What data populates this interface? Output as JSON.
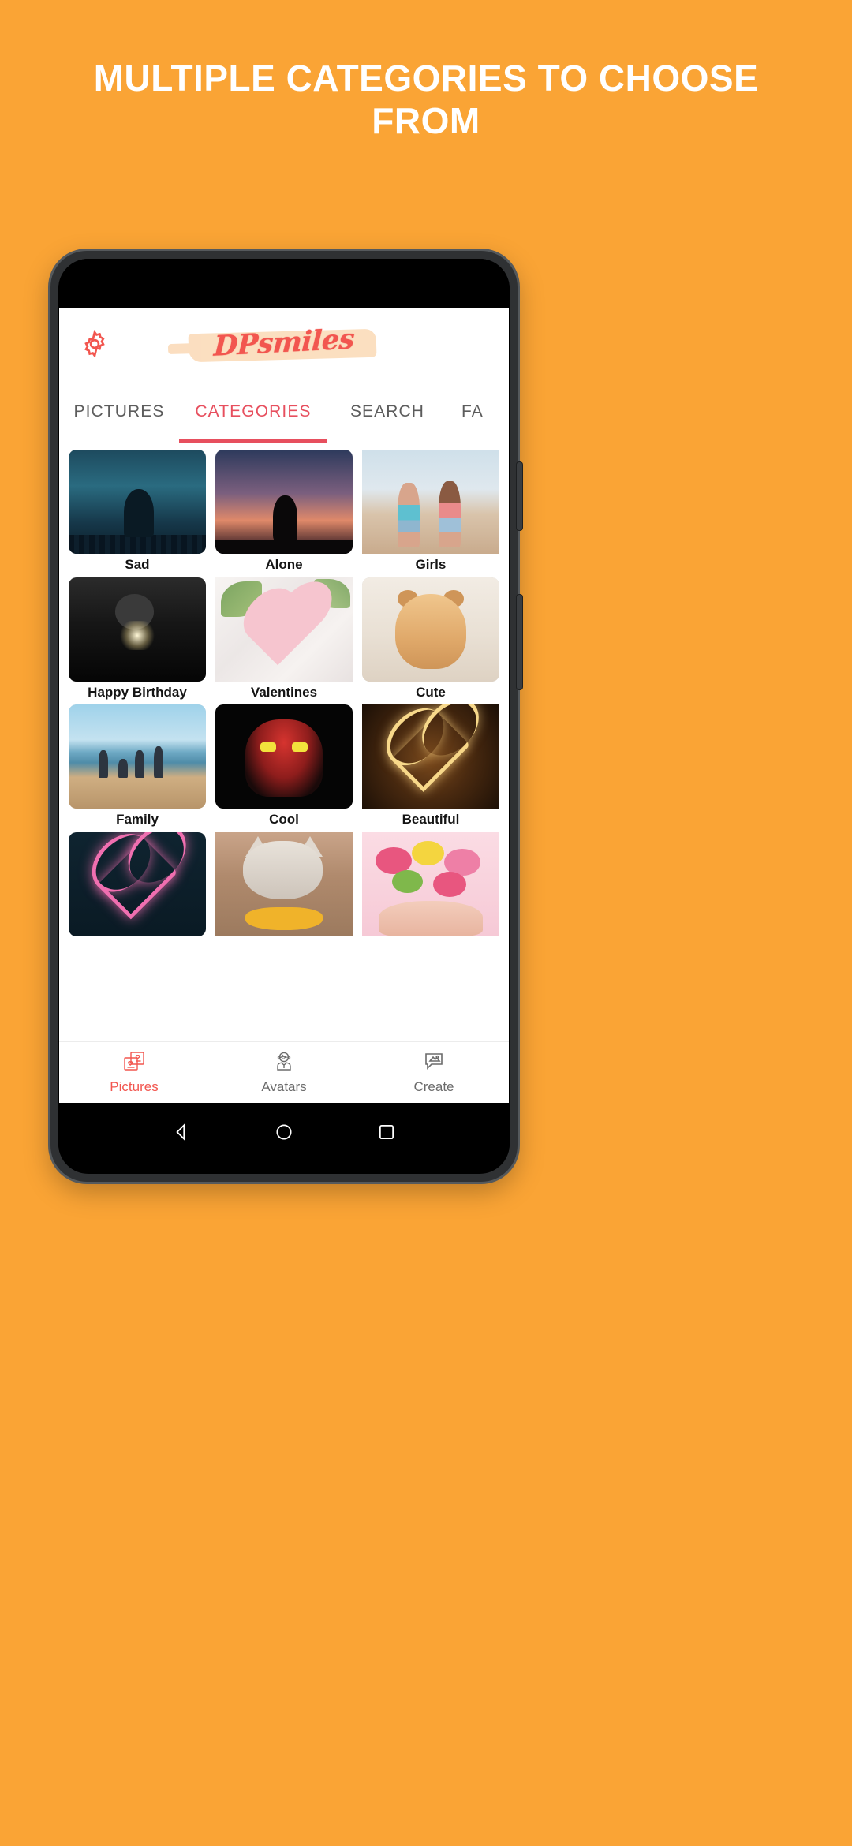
{
  "promo": {
    "headline": "MULTIPLE CATEGORIES TO CHOOSE FROM"
  },
  "colors": {
    "background": "#FAA435",
    "accent": "#E74F5E",
    "brand": "#F2564F",
    "brush": "#FBDCBB",
    "inactive": "#5c5c5c"
  },
  "app": {
    "brand": "DPsmiles",
    "settings_icon": "gear-icon",
    "tabs": [
      {
        "label": "PICTURES",
        "active": false
      },
      {
        "label": "CATEGORIES",
        "active": true
      },
      {
        "label": "SEARCH",
        "active": false
      },
      {
        "label": "FA",
        "active": false
      }
    ],
    "categories": [
      {
        "label": "Sad"
      },
      {
        "label": "Alone"
      },
      {
        "label": "Girls"
      },
      {
        "label": "Happy Birthday"
      },
      {
        "label": "Valentines"
      },
      {
        "label": "Cute"
      },
      {
        "label": "Family"
      },
      {
        "label": "Cool"
      },
      {
        "label": "Beautiful"
      },
      {
        "label": ""
      },
      {
        "label": ""
      },
      {
        "label": ""
      }
    ],
    "bottom_nav": [
      {
        "label": "Pictures",
        "icon": "pictures-icon",
        "active": true
      },
      {
        "label": "Avatars",
        "icon": "avatar-icon",
        "active": false
      },
      {
        "label": "Create",
        "icon": "create-icon",
        "active": false
      }
    ]
  },
  "android_nav": {
    "back": "back-triangle-icon",
    "home": "home-circle-icon",
    "recents": "recents-square-icon"
  }
}
